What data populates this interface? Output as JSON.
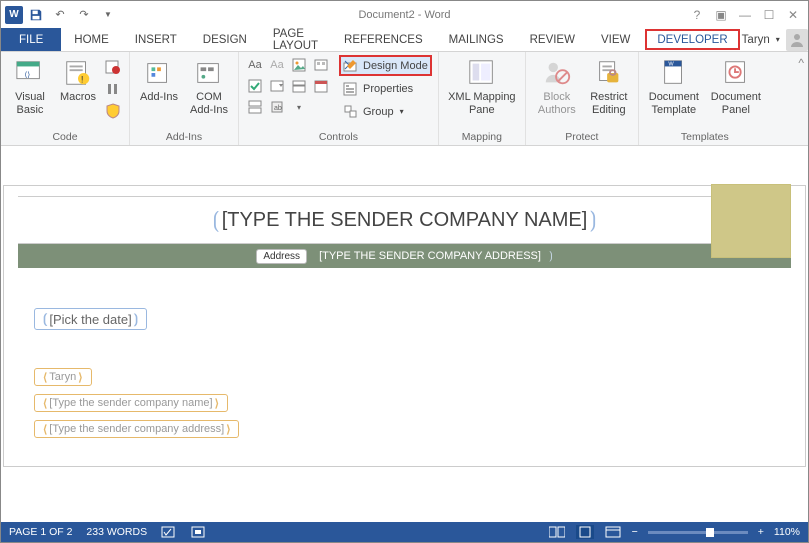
{
  "titlebar": {
    "doc_title": "Document2 - Word"
  },
  "tabs": {
    "file": "FILE",
    "home": "HOME",
    "insert": "INSERT",
    "design": "DESIGN",
    "page_layout": "PAGE LAYOUT",
    "references": "REFERENCES",
    "mailings": "MAILINGS",
    "review": "REVIEW",
    "view": "VIEW",
    "developer": "DEVELOPER"
  },
  "user": {
    "name": "Taryn"
  },
  "ribbon": {
    "code": {
      "label": "Code",
      "visual_basic": "Visual\nBasic",
      "macros": "Macros"
    },
    "addins": {
      "label": "Add-Ins",
      "addins": "Add-Ins",
      "com": "COM\nAdd-Ins"
    },
    "controls": {
      "label": "Controls",
      "design_mode": "Design Mode",
      "properties": "Properties",
      "group": "Group"
    },
    "mapping": {
      "label": "Mapping",
      "xml_pane": "XML Mapping\nPane"
    },
    "protect": {
      "label": "Protect",
      "block_authors": "Block\nAuthors",
      "restrict": "Restrict\nEditing"
    },
    "templates": {
      "label": "Templates",
      "doc_template": "Document\nTemplate",
      "doc_panel": "Document\nPanel"
    }
  },
  "doc": {
    "title_cc": "[TYPE THE SENDER COMPANY NAME]",
    "address_tag": "Address",
    "address_cc": "[TYPE THE SENDER COMPANY ADDRESS]",
    "date_cc": "[Pick the date]",
    "name_cc": "Taryn",
    "company_cc": "[Type the sender company name]",
    "compaddr_cc": "[Type the sender company address]"
  },
  "status": {
    "page": "PAGE 1 OF 2",
    "words": "233 WORDS",
    "zoom": "110%"
  }
}
